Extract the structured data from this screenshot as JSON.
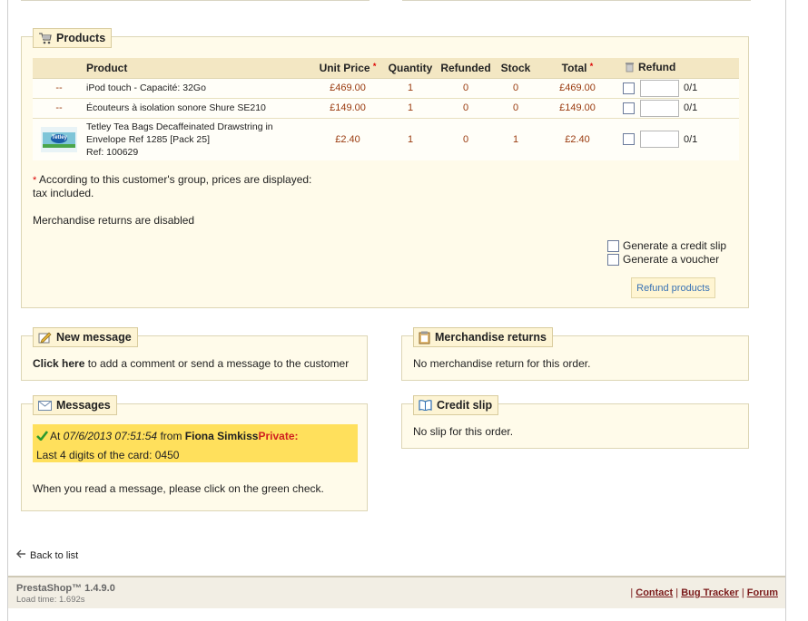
{
  "products": {
    "legend": "Products",
    "columns": [
      "Product",
      "Unit Price",
      "Quantity",
      "Refunded",
      "Stock",
      "Total",
      "Refund"
    ],
    "rows": [
      {
        "image": "--",
        "name_lines": [
          "iPod touch - Capacité: 32Go"
        ],
        "unit_price": "£469.00",
        "quantity": "1",
        "refunded": "0",
        "stock": "0",
        "total": "£469.00",
        "refund_of": "0/1"
      },
      {
        "image": "--",
        "name_lines": [
          "Écouteurs à isolation sonore Shure SE210"
        ],
        "unit_price": "£149.00",
        "quantity": "1",
        "refunded": "0",
        "stock": "0",
        "total": "£149.00",
        "refund_of": "0/1"
      },
      {
        "image": "Tetley",
        "name_lines": [
          "Tetley Tea Bags Decaffeinated Drawstring in",
          "Envelope Ref 1285 [Pack 25]",
          "Ref: 100629"
        ],
        "unit_price": "£2.40",
        "quantity": "1",
        "refunded": "0",
        "stock": "1",
        "total": "£2.40",
        "refund_of": "0/1"
      }
    ],
    "asterisk": "*",
    "note_line1": "According to this customer's group, prices are displayed:",
    "note_line2": "tax included.",
    "returns_disabled": "Merchandise returns are disabled",
    "option_credit_slip": "Generate a credit slip",
    "option_voucher": "Generate a voucher",
    "refund_button": "Refund products"
  },
  "new_message": {
    "legend": "New message",
    "link": "Click here",
    "text": " to add a comment or send a message to the customer"
  },
  "merch_returns": {
    "legend": "Merchandise returns",
    "text": "No merchandise return for this order."
  },
  "messages": {
    "legend": "Messages",
    "at": "At ",
    "date": "07/6/2013 07:51:54",
    "from": " from ",
    "author": "Fiona Simkiss",
    "private": "Private:",
    "body": "Last 4 digits of the card: 0450",
    "hint": "When you read a message, please click on the green check."
  },
  "credit_slip": {
    "legend": "Credit slip",
    "text": "No slip for this order."
  },
  "back_link": "Back to list",
  "footer": {
    "brand": "PrestaShop™ 1.4.9.0",
    "load_time": "Load time: 1.692s",
    "sep": "|",
    "links": [
      "Contact",
      "Bug Tracker",
      "Forum"
    ]
  }
}
